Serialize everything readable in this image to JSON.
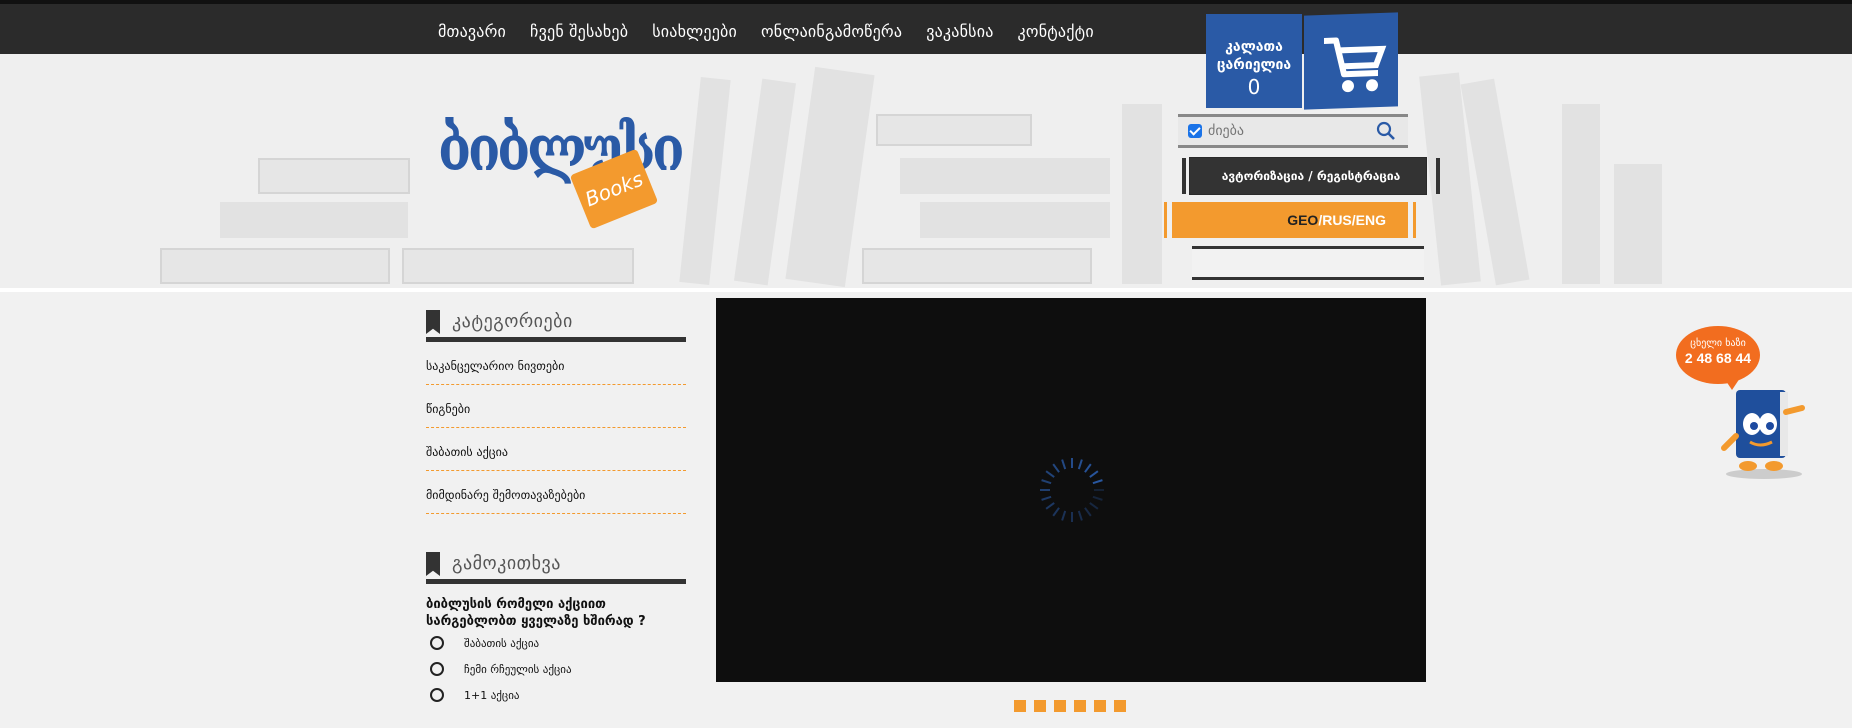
{
  "nav": {
    "items": [
      "მთავარი",
      "ჩვენ შესახებ",
      "სიახლეები",
      "ონლაინგამოწერა",
      "ვაკანსია",
      "კონტაქტი"
    ]
  },
  "logo": {
    "text": "ბიბლუსი",
    "books": "Books"
  },
  "cart": {
    "label_line1": "კალათა",
    "label_line2": "ცარიელია",
    "count": "0"
  },
  "search": {
    "placeholder": "ძიება"
  },
  "auth": {
    "label": "ავტორიზაცია / რეგისტრაცია"
  },
  "language": {
    "geo": "GEO",
    "sep1": "/",
    "rus": "RUS",
    "sep2": "/",
    "eng": "ENG"
  },
  "categories": {
    "title": "კატეგორიები",
    "items": [
      "საკანცელარიო ნივთები",
      "წიგნები",
      "შაბათის აქცია",
      "მიმდინარე შემოთავაზებები"
    ]
  },
  "poll": {
    "title": "გამოკითხვა",
    "question": "ბიბლუსის რომელი აქციით სარგებლობთ ყველაზე ხშირად ?",
    "options": [
      "შაბათის აქცია",
      "ჩემი რჩეულის აქცია",
      "1+1 აქცია"
    ]
  },
  "hotline": {
    "label": "ცხელი ხაზი",
    "phone": "2 48 68 44"
  },
  "colors": {
    "accent": "#f39a2e",
    "brand": "#2a5aa6",
    "dark": "#2b2b2b"
  }
}
